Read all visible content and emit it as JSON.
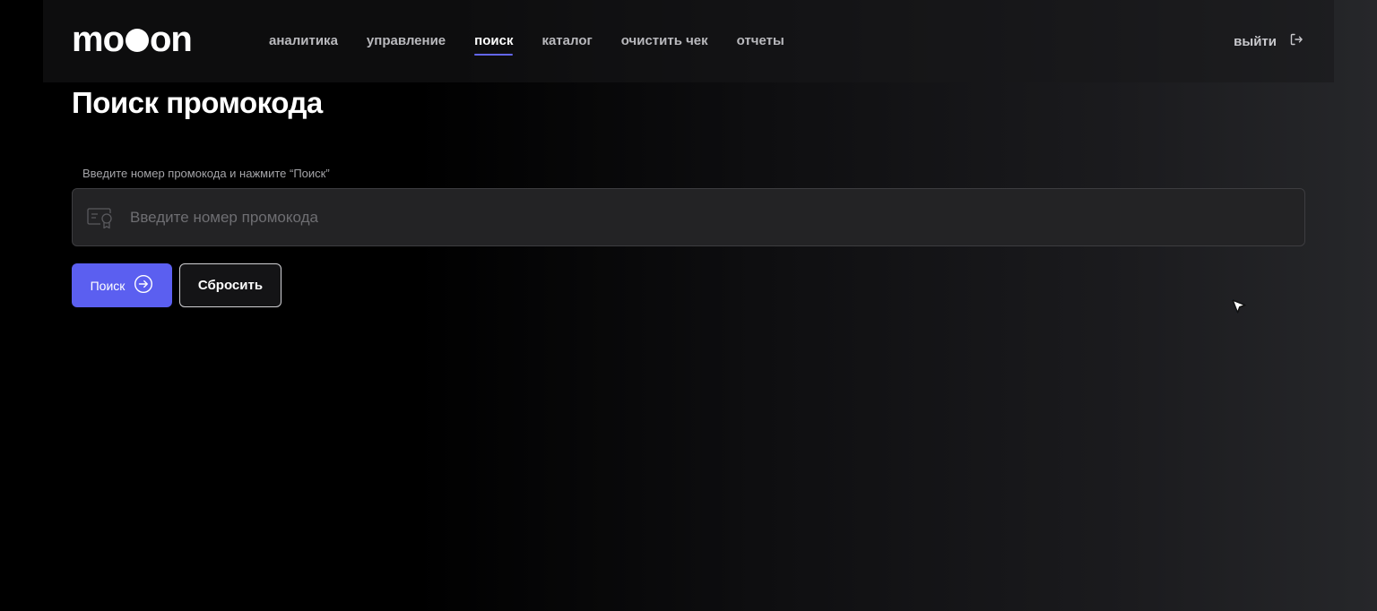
{
  "brand": {
    "logo_pre": "mo",
    "logo_post": "on"
  },
  "nav": {
    "items": [
      {
        "label": "аналитика"
      },
      {
        "label": "управление"
      },
      {
        "label": "поиск"
      },
      {
        "label": "каталог"
      },
      {
        "label": "очистить чек"
      },
      {
        "label": "отчеты"
      }
    ],
    "active_index": 2,
    "logout_label": "выйти"
  },
  "main": {
    "title": "Поиск промокода",
    "field_label": "Введите номер промокода и нажмите “Поиск”",
    "input": {
      "value": "",
      "placeholder": "Введите номер промокода"
    },
    "search_button_label": "Поиск",
    "reset_button_label": "Сбросить"
  },
  "icons": {
    "logout": "logout-icon",
    "input": "certificate-icon",
    "search_button": "arrow-circle-right-icon",
    "cursor": "mouse-cursor-icon"
  },
  "colors": {
    "accent": "#5b5ff0",
    "background": "#000000",
    "input_bg": "#232325"
  }
}
